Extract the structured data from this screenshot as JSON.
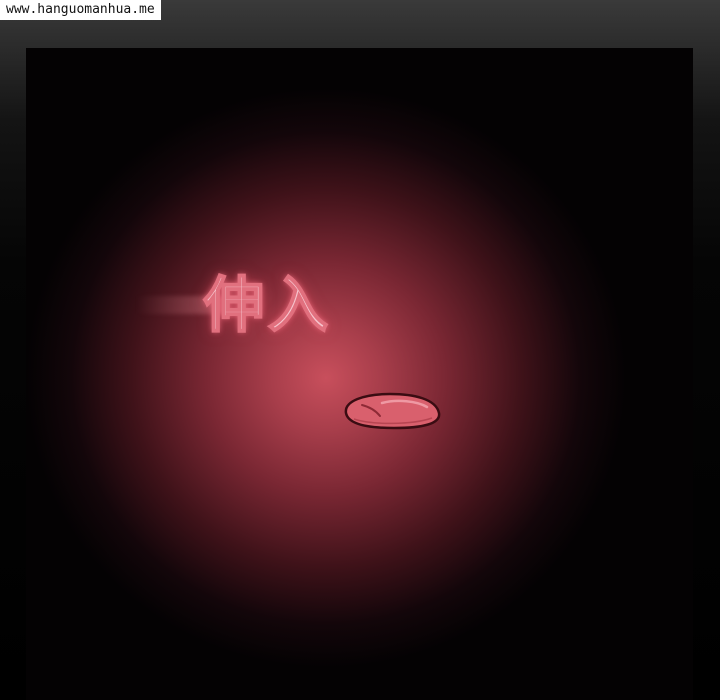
{
  "watermark": {
    "text": "www.hanguomanhua.me"
  },
  "panel": {
    "sound_effect": "伸入"
  },
  "colors": {
    "glow_center": "#c84f5c",
    "glow_edge": "#040203",
    "sfx_fill": "#f6c3cc",
    "sfx_outline": "#e1707e",
    "tongue_fill": "#d9606d",
    "tongue_outline": "#3a0c12"
  }
}
